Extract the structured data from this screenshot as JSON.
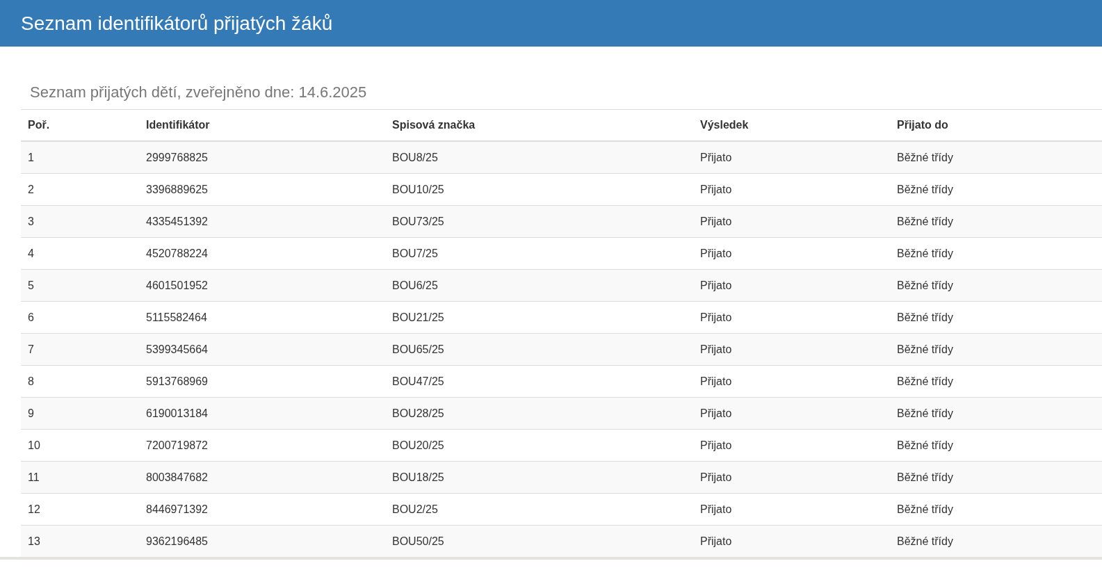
{
  "header": {
    "title": "Seznam identifikátorů přijatých žáků"
  },
  "subtitle": "Seznam přijatých dětí, zveřejněno dne: 14.6.2025",
  "table": {
    "columns": [
      "Poř.",
      "Identifikátor",
      "Spisová značka",
      "Výsledek",
      "Přijato do"
    ],
    "rows": [
      [
        "1",
        "2999768825",
        "BOU8/25",
        "Přijato",
        "Běžné třídy"
      ],
      [
        "2",
        "3396889625",
        "BOU10/25",
        "Přijato",
        "Běžné třídy"
      ],
      [
        "3",
        "4335451392",
        "BOU73/25",
        "Přijato",
        "Běžné třídy"
      ],
      [
        "4",
        "4520788224",
        "BOU7/25",
        "Přijato",
        "Běžné třídy"
      ],
      [
        "5",
        "4601501952",
        "BOU6/25",
        "Přijato",
        "Běžné třídy"
      ],
      [
        "6",
        "5115582464",
        "BOU21/25",
        "Přijato",
        "Běžné třídy"
      ],
      [
        "7",
        "5399345664",
        "BOU65/25",
        "Přijato",
        "Běžné třídy"
      ],
      [
        "8",
        "5913768969",
        "BOU47/25",
        "Přijato",
        "Běžné třídy"
      ],
      [
        "9",
        "6190013184",
        "BOU28/25",
        "Přijato",
        "Běžné třídy"
      ],
      [
        "10",
        "7200719872",
        "BOU20/25",
        "Přijato",
        "Běžné třídy"
      ],
      [
        "11",
        "8003847682",
        "BOU18/25",
        "Přijato",
        "Běžné třídy"
      ],
      [
        "12",
        "8446971392",
        "BOU2/25",
        "Přijato",
        "Běžné třídy"
      ],
      [
        "13",
        "9362196485",
        "BOU50/25",
        "Přijato",
        "Běžné třídy"
      ]
    ]
  }
}
